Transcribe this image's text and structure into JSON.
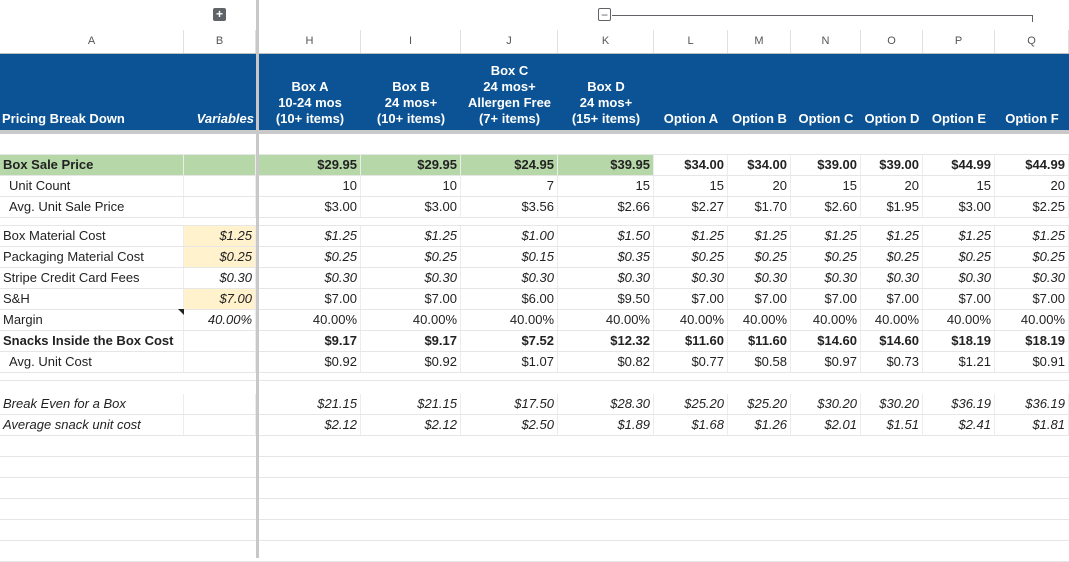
{
  "toolbar": {
    "expand_group": "+",
    "collapse_group": "−"
  },
  "columns": [
    "A",
    "B",
    "H",
    "I",
    "J",
    "K",
    "L",
    "M",
    "N",
    "O",
    "P",
    "Q"
  ],
  "header": {
    "a": "Pricing Break Down",
    "b": "Variables",
    "h": [
      "Box A",
      "10-24 mos",
      "(10+ items)"
    ],
    "i": [
      "Box B",
      "24 mos+",
      "(10+ items)"
    ],
    "j": [
      "Box C",
      "24 mos+",
      "Allergen Free",
      "(7+ items)"
    ],
    "k": [
      "Box D",
      "24 mos+",
      "(15+ items)"
    ],
    "l": "Option A",
    "m": "Option B",
    "n": "Option C",
    "o": "Option D",
    "p": "Option E",
    "q": "Option F"
  },
  "rows": {
    "box_sale_price": {
      "label": "Box Sale Price",
      "b": "",
      "vals": [
        "$29.95",
        "$29.95",
        "$24.95",
        "$39.95",
        "$34.00",
        "$34.00",
        "$39.00",
        "$39.00",
        "$44.99",
        "$44.99"
      ]
    },
    "unit_count": {
      "label": "Unit Count",
      "b": "",
      "vals": [
        "10",
        "10",
        "7",
        "15",
        "15",
        "20",
        "15",
        "20",
        "15",
        "20"
      ]
    },
    "avg_unit_sale": {
      "label": "Avg. Unit Sale Price",
      "b": "",
      "vals": [
        "$3.00",
        "$3.00",
        "$3.56",
        "$2.66",
        "$2.27",
        "$1.70",
        "$2.60",
        "$1.95",
        "$3.00",
        "$2.25"
      ]
    },
    "box_material": {
      "label": "Box Material Cost",
      "b": "$1.25",
      "vals": [
        "$1.25",
        "$1.25",
        "$1.00",
        "$1.50",
        "$1.25",
        "$1.25",
        "$1.25",
        "$1.25",
        "$1.25",
        "$1.25"
      ]
    },
    "packaging": {
      "label": "Packaging Material Cost",
      "b": "$0.25",
      "vals": [
        "$0.25",
        "$0.25",
        "$0.15",
        "$0.35",
        "$0.25",
        "$0.25",
        "$0.25",
        "$0.25",
        "$0.25",
        "$0.25"
      ]
    },
    "stripe": {
      "label": "Stripe Credit Card Fees",
      "b": "$0.30",
      "vals": [
        "$0.30",
        "$0.30",
        "$0.30",
        "$0.30",
        "$0.30",
        "$0.30",
        "$0.30",
        "$0.30",
        "$0.30",
        "$0.30"
      ]
    },
    "sh": {
      "label": "S&H",
      "b": "$7.00",
      "vals": [
        "$7.00",
        "$7.00",
        "$6.00",
        "$9.50",
        "$7.00",
        "$7.00",
        "$7.00",
        "$7.00",
        "$7.00",
        "$7.00"
      ]
    },
    "margin": {
      "label": "Margin",
      "b": "40.00%",
      "vals": [
        "40.00%",
        "40.00%",
        "40.00%",
        "40.00%",
        "40.00%",
        "40.00%",
        "40.00%",
        "40.00%",
        "40.00%",
        "40.00%"
      ]
    },
    "snacks_cost": {
      "label": "Snacks Inside the Box Cost",
      "b": "",
      "vals": [
        "$9.17",
        "$9.17",
        "$7.52",
        "$12.32",
        "$11.60",
        "$11.60",
        "$14.60",
        "$14.60",
        "$18.19",
        "$18.19"
      ]
    },
    "avg_unit_cost": {
      "label": "Avg. Unit Cost",
      "b": "",
      "vals": [
        "$0.92",
        "$0.92",
        "$1.07",
        "$0.82",
        "$0.77",
        "$0.58",
        "$0.97",
        "$0.73",
        "$1.21",
        "$0.91"
      ]
    },
    "break_even": {
      "label": "Break Even for a Box",
      "b": "",
      "vals": [
        "$21.15",
        "$21.15",
        "$17.50",
        "$28.30",
        "$25.20",
        "$25.20",
        "$30.20",
        "$30.20",
        "$36.19",
        "$36.19"
      ]
    },
    "avg_snack": {
      "label": "Average snack unit cost",
      "b": "",
      "vals": [
        "$2.12",
        "$2.12",
        "$2.50",
        "$1.89",
        "$1.68",
        "$1.26",
        "$2.01",
        "$1.51",
        "$2.41",
        "$1.81"
      ]
    }
  }
}
